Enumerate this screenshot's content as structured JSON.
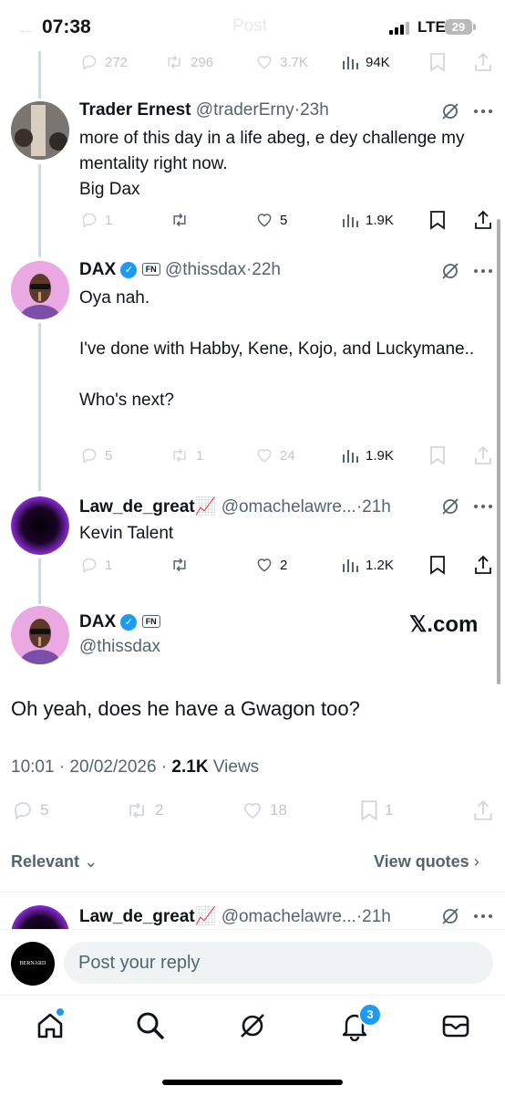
{
  "status_bar": {
    "time": "07:38",
    "network": "LTE",
    "battery": "29",
    "header_ghost": "Post"
  },
  "prev_actions": {
    "replies": "272",
    "reposts": "296",
    "likes": "3.7K",
    "views": "94K"
  },
  "tweet1": {
    "name": "Trader Ernest",
    "handle": "@traderErny",
    "sep": "·",
    "time": "23h",
    "text": "more of this day in a life abeg, e dey challenge my mentality right now.\nBig Dax",
    "replies": "1",
    "likes": "5",
    "views": "1.9K"
  },
  "tweet2": {
    "name": "DAX",
    "badge": "FN",
    "handle": "@thissdax",
    "sep": "·",
    "time": "22h",
    "text": "Oya nah.\n\nI've done with Habby, Kene, Kojo, and Luckymane..\n\nWho's next?",
    "replies": "5",
    "reposts": "1",
    "likes": "24",
    "views": "1.9K"
  },
  "tweet3": {
    "name": "Law_de_great",
    "emoji": "📈",
    "handle": "@omachelawre...",
    "sep": "·",
    "time": "21h",
    "text": "Kevin Talent",
    "replies": "1",
    "likes": "2",
    "views": "1.2K"
  },
  "main_tweet": {
    "name": "DAX",
    "badge": "FN",
    "handle": "@thissdax",
    "source": "𝕏.com",
    "text": "Oh yeah, does he have a Gwagon too?",
    "timestamp": "10:01 · 20/02/2026 · ",
    "views_count": "2.1K",
    "views_label": " Views",
    "replies": "5",
    "reposts": "2",
    "likes": "18",
    "bookmarks": "1"
  },
  "sort": {
    "relevant": "Relevant",
    "view_quotes": "View quotes"
  },
  "reply_preview": {
    "name": "Law_de_great",
    "emoji": "📈",
    "handle": "@omachelawre...",
    "sep": "·",
    "time": "21h"
  },
  "reply_bar": {
    "avatar_text": "BERNARD",
    "placeholder": "Post your reply"
  },
  "bottom_nav": {
    "notifications_badge": "3"
  },
  "colors": {
    "accent": "#1d9bf0",
    "text": "#0f1419",
    "muted": "#536471",
    "badge": "#1d9bf0"
  }
}
